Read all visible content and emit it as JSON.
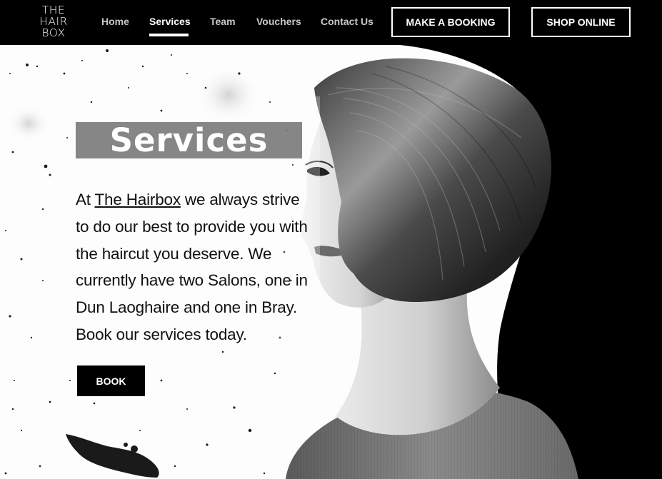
{
  "logo": {
    "line1": "THE",
    "line2": "HAIR",
    "line3": "BOX"
  },
  "nav": {
    "items": [
      {
        "label": "Home"
      },
      {
        "label": "Services"
      },
      {
        "label": "Team"
      },
      {
        "label": "Vouchers"
      },
      {
        "label": "Contact Us"
      }
    ],
    "active": "Services",
    "booking_label": "MAKE A BOOKING",
    "shop_label": "SHOP ONLINE"
  },
  "hero": {
    "title": "Services",
    "text_before": "At ",
    "link_text": "The Hairbox",
    "text_after": " we always strive to do our best to provide you with the haircut you deserve. We currently have two Salons, one in Dun Laoghaire and one in Bray. Book our services today.",
    "book_label": "BOOK"
  },
  "colors": {
    "header_bg": "#000000",
    "title_box": "#808080",
    "text": "#111111",
    "accent": "#ffffff"
  }
}
